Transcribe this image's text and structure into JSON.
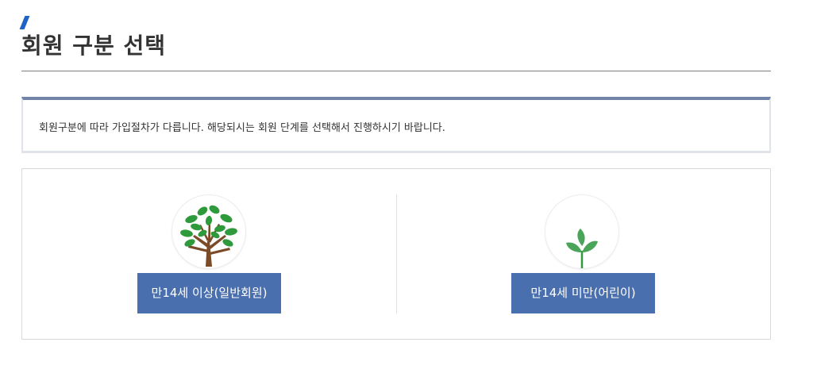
{
  "header": {
    "title": "회원 구분 선택"
  },
  "notice": {
    "text": "회원구분에 따라 가입절차가 다릅니다. 해당되시는 회원 단계를 선택해서 진행하시기 바랍니다."
  },
  "choices": [
    {
      "icon": "tree-icon",
      "label": "만14세 이상(일반회원)"
    },
    {
      "icon": "sprout-icon",
      "label": "만14세 미만(어린이)"
    }
  ],
  "colors": {
    "accent": "#1e64c8",
    "button_bg": "#4a6fae",
    "notice_border": "#6f84a6",
    "leaf_green": "#2f9a3c",
    "trunk_brown": "#7b4a26"
  }
}
